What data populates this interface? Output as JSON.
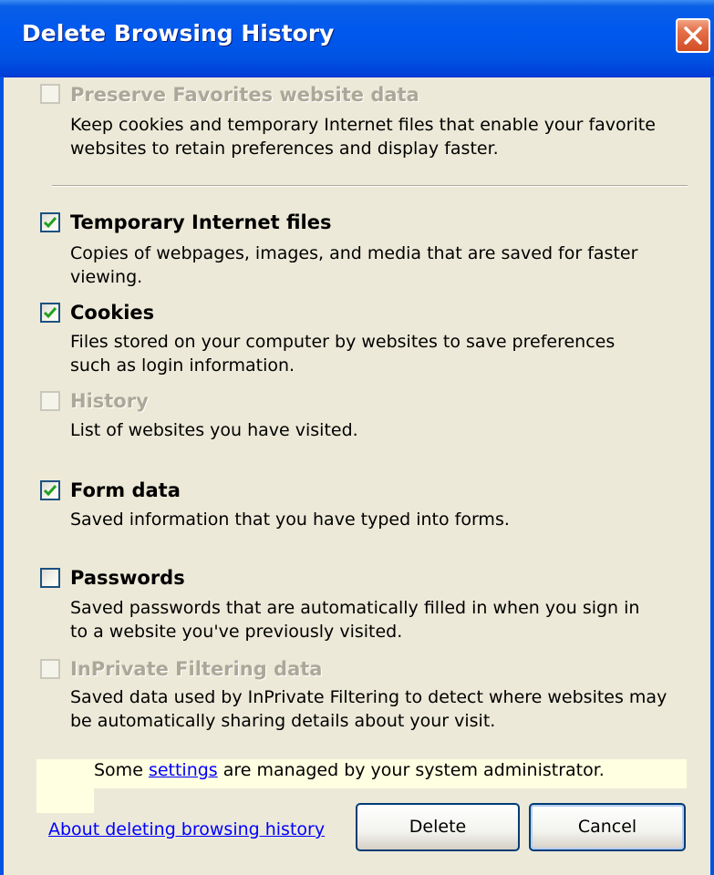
{
  "window": {
    "title": "Delete Browsing History"
  },
  "options": [
    {
      "label": "Preserve Favorites website data",
      "description": [
        "Keep cookies and temporary Internet files that enable your favorite",
        "websites to retain preferences and display faster."
      ],
      "checked": false,
      "enabled": false
    },
    {
      "label": "Temporary Internet files",
      "description": [
        "Copies of webpages, images, and media that are saved for faster",
        "viewing."
      ],
      "checked": true,
      "enabled": true
    },
    {
      "label": "Cookies",
      "description": [
        "Files stored on your computer by websites to save preferences",
        "such as login information."
      ],
      "checked": true,
      "enabled": true
    },
    {
      "label": "History",
      "description": [
        "List of websites you have visited."
      ],
      "checked": false,
      "enabled": false
    },
    {
      "label": "Form data",
      "description": [
        "Saved information that you have typed into forms."
      ],
      "checked": true,
      "enabled": true
    },
    {
      "label": "Passwords",
      "description": [
        "Saved passwords that are automatically filled in when you sign in",
        "to a website you've previously visited."
      ],
      "checked": false,
      "enabled": true
    },
    {
      "label": "InPrivate Filtering data",
      "description": [
        "Saved data used by InPrivate Filtering to detect where websites may",
        "be automatically sharing details about your visit."
      ],
      "checked": false,
      "enabled": false
    }
  ],
  "notice": {
    "prefix": "Some ",
    "link": "settings",
    "suffix": " are managed by your system administrator."
  },
  "footer": {
    "about_link": "About deleting browsing history",
    "delete_label": "Delete",
    "cancel_label": "Cancel"
  },
  "colors": {
    "titlebar": "#0054E3",
    "dialog_bg": "#ECE9D8",
    "close_button": "#D24E24",
    "notice_bg": "#FFFFE1",
    "link": "#0000FF",
    "disabled_text": "#ACA899"
  }
}
